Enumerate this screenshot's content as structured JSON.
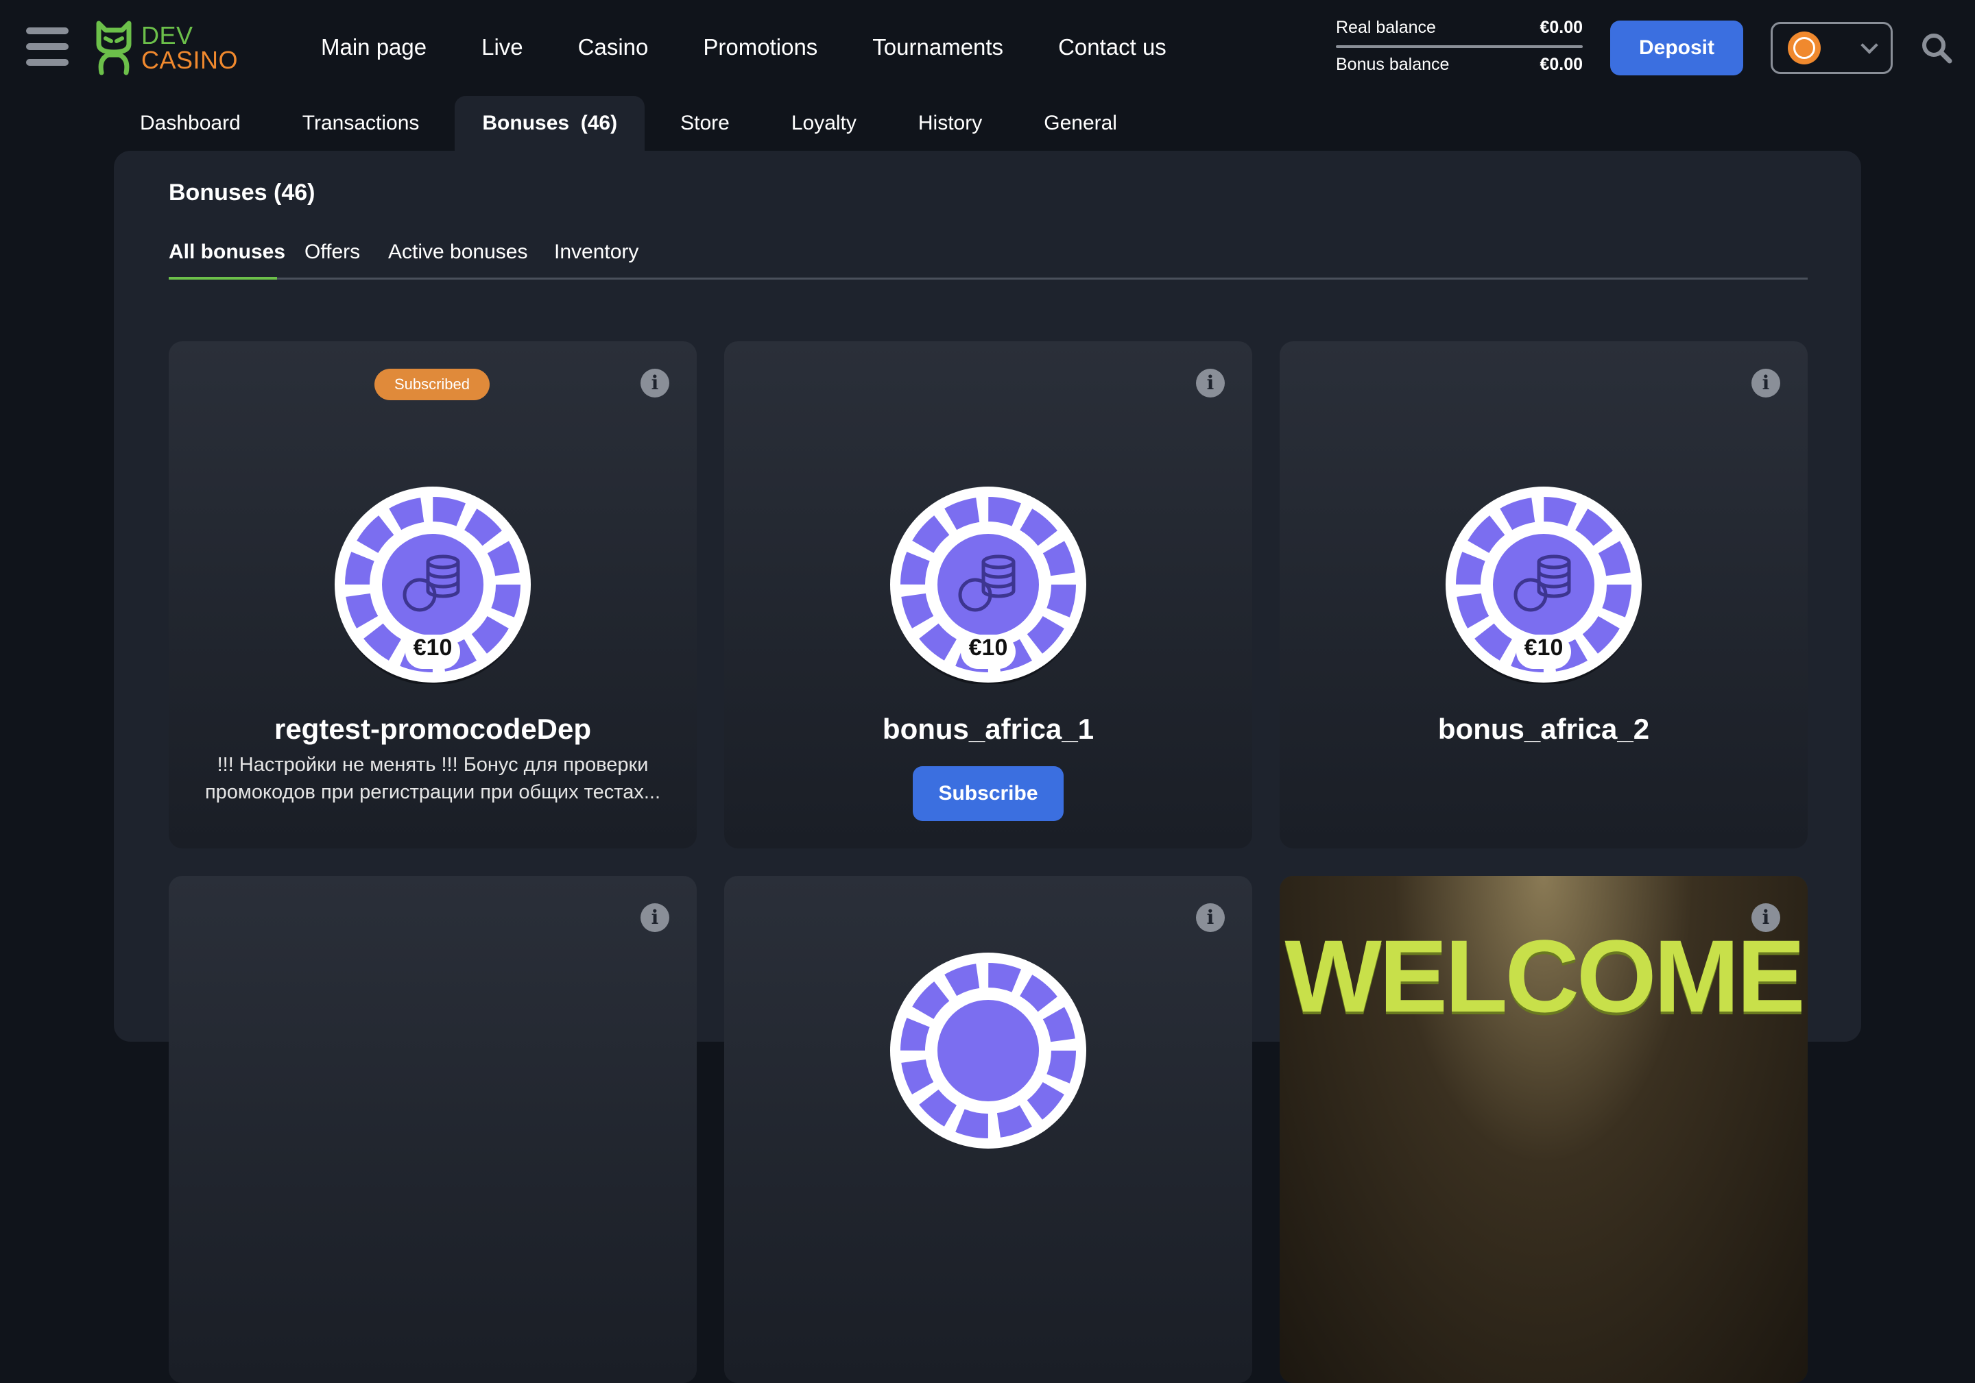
{
  "header": {
    "logo": {
      "line1": "DEV",
      "line2": "CASINO"
    },
    "nav": [
      "Main page",
      "Live",
      "Casino",
      "Promotions",
      "Tournaments",
      "Contact us"
    ],
    "real_balance_label": "Real balance",
    "real_balance_value": "€0.00",
    "bonus_balance_label": "Bonus balance",
    "bonus_balance_value": "€0.00",
    "deposit_label": "Deposit"
  },
  "tabs": [
    "Dashboard",
    "Transactions",
    "Bonuses  (46)",
    "Store",
    "Loyalty",
    "History",
    "General"
  ],
  "panel": {
    "title": "Bonuses (46)",
    "subtabs": [
      "All bonuses",
      "Offers",
      "Active bonuses",
      "Inventory"
    ]
  },
  "cards": [
    {
      "badge": "Subscribed",
      "amount": "€10",
      "title": "regtest-promocodeDep",
      "description": "!!! Настройки не менять !!! Бонус для проверки промокодов при регистрации при общих тестах..."
    },
    {
      "amount": "€10",
      "title": "bonus_africa_1",
      "button": "Subscribe"
    },
    {
      "amount": "€10",
      "title": "bonus_africa_2"
    }
  ],
  "bottom_cards": [
    {},
    {},
    {
      "banner_text": "WELCOME"
    }
  ],
  "colors": {
    "accent": "#3b6fe0",
    "badge": "#e08a3a",
    "chip_purple": "#7b6ef0",
    "logo_green": "#6cc04a",
    "logo_orange": "#f0892e"
  }
}
